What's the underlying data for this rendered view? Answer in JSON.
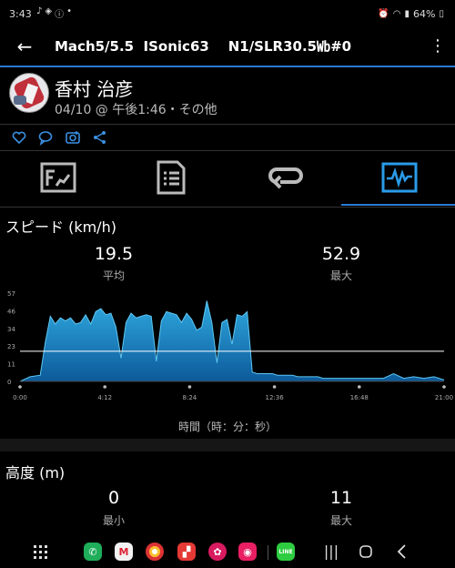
{
  "status_bar": {
    "time": "3:43",
    "battery": "64%",
    "icons_left": [
      "tiktok-icon",
      "shield-icon",
      "info-icon",
      "dot-icon"
    ],
    "icons_right": [
      "alarm-icon",
      "wifi-icon",
      "signal-icon",
      "battery-icon"
    ]
  },
  "app_bar": {
    "title": "Mach5/5.5  ISonic63    N1/SLR30.5㏝#0"
  },
  "profile": {
    "name": "香村 治彦",
    "meta": "04/10 @ 午後1:46・その他"
  },
  "actions": [
    "heart-icon",
    "comment-icon",
    "camera-icon",
    "share-icon"
  ],
  "tabs": [
    {
      "icon": "summary-icon",
      "active": false
    },
    {
      "icon": "document-icon",
      "active": false
    },
    {
      "icon": "loop-icon",
      "active": false
    },
    {
      "icon": "activity-chart-icon",
      "active": true
    }
  ],
  "speed_section": {
    "title": "スピード (km/h)",
    "avg_value": "19.5",
    "avg_label": "平均",
    "max_value": "52.9",
    "max_label": "最大"
  },
  "chart_data": {
    "type": "area",
    "title": "",
    "xlabel": "時間（時：分：秒）",
    "ylabel": "",
    "x_tick_labels": [
      "0:00",
      "4:12",
      "8:24",
      "12:36",
      "16:48",
      "21:00"
    ],
    "y_tick_labels": [
      "0",
      "11",
      "23",
      "34",
      "46",
      "57"
    ],
    "ylim": [
      0,
      57
    ],
    "xlim": [
      0,
      1260
    ],
    "reference_line": {
      "value": 19.5,
      "color": "#ffffff"
    },
    "colors": {
      "fill_top": "#2fa9e0",
      "fill_bottom": "#0d5a9a"
    },
    "x": [
      0,
      30,
      60,
      75,
      90,
      105,
      120,
      135,
      150,
      165,
      180,
      195,
      210,
      225,
      240,
      255,
      270,
      285,
      300,
      315,
      330,
      345,
      360,
      375,
      390,
      405,
      420,
      435,
      450,
      465,
      480,
      495,
      510,
      525,
      540,
      555,
      570,
      585,
      600,
      615,
      630,
      645,
      660,
      675,
      690,
      705,
      720,
      735,
      750,
      765,
      780,
      795,
      810,
      825,
      840,
      855,
      870,
      885,
      900,
      960,
      1020,
      1080,
      1110,
      1140,
      1170,
      1200,
      1230,
      1260
    ],
    "values": [
      0,
      3,
      4,
      25,
      42,
      37,
      41,
      39,
      41,
      37,
      38,
      43,
      37,
      45,
      47,
      43,
      44,
      35,
      15,
      38,
      44,
      41,
      42,
      43,
      42,
      13,
      39,
      45,
      44,
      43,
      38,
      44,
      40,
      33,
      35,
      52,
      38,
      12,
      38,
      40,
      24,
      43,
      42,
      45,
      6,
      5,
      5,
      5,
      5,
      4,
      4,
      4,
      4,
      3,
      3,
      3,
      3,
      3,
      2,
      2,
      2,
      2,
      5,
      2,
      3,
      2,
      3,
      1
    ]
  },
  "altitude_section": {
    "title": "高度 (m)",
    "min_value": "0",
    "min_label": "最小",
    "max_value": "11",
    "max_label": "最大"
  },
  "nav_bar": {
    "apps": [
      "apps-grid-icon",
      "phone-icon",
      "gmail-icon",
      "chrome-icon",
      "app-red-icon",
      "flower-icon",
      "camera-app-icon",
      "line-icon"
    ],
    "line_label": "LINE",
    "buttons": [
      "recents-button",
      "home-button",
      "back-nav-button"
    ]
  }
}
